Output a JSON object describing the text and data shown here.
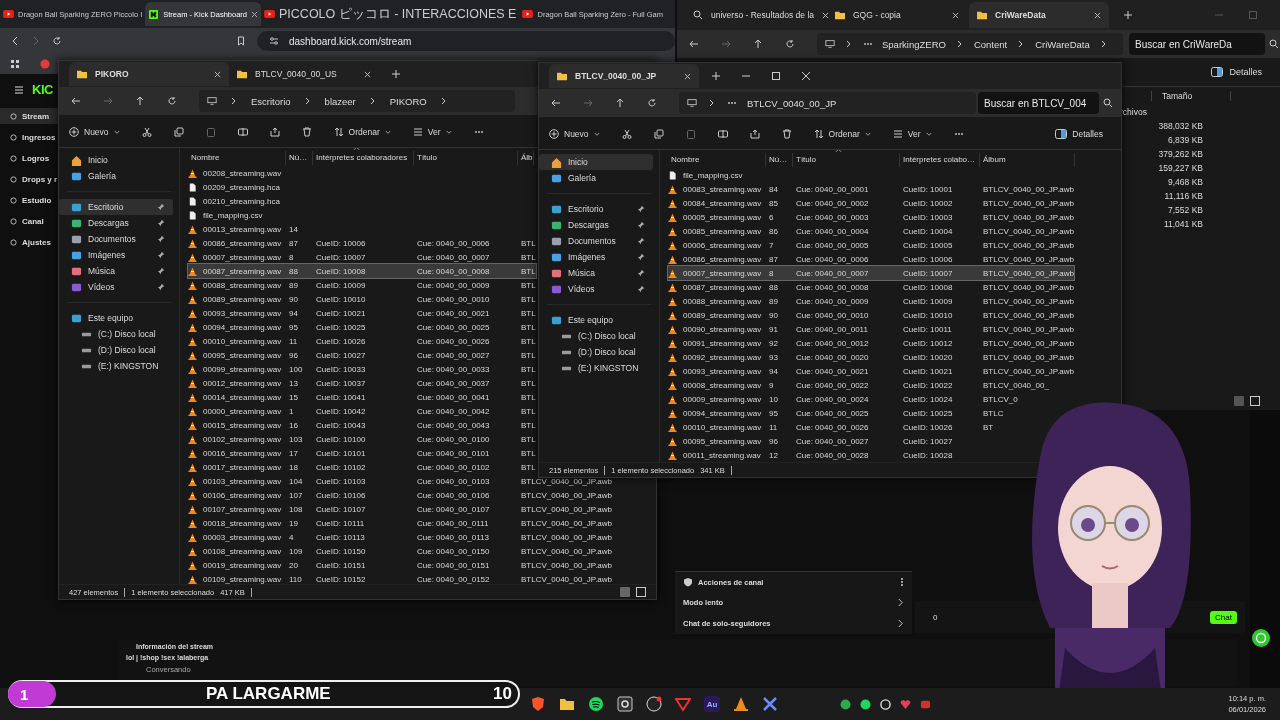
{
  "browser": {
    "tabs": [
      {
        "title": "Dragon Ball Sparking ZERO Piccolo I",
        "kind": "video",
        "selected": false
      },
      {
        "title": "Stream - Kick Dashboard",
        "kind": "kick",
        "selected": true
      },
      {
        "title": "PICCOLO ピッコロ - INTERACCIONES E",
        "kind": "video",
        "selected": false
      },
      {
        "title": "Dragon Ball Sparking Zero - Full Gam",
        "kind": "video",
        "selected": false
      }
    ],
    "url": "dashboard.kick.com/stream"
  },
  "kick": {
    "logo": "KIC",
    "nav": [
      {
        "label": "Stream",
        "selected": true
      },
      {
        "label": "Ingresos",
        "selected": false
      },
      {
        "label": "Logros",
        "selected": false
      },
      {
        "label": "Drops y r",
        "selected": false
      },
      {
        "label": "Estudio",
        "selected": false
      },
      {
        "label": "Canal",
        "selected": false
      },
      {
        "label": "Ajustes",
        "selected": false
      }
    ],
    "channel_actions": {
      "title": "Acciones de canal",
      "items": [
        "Modo lento",
        "Chat de solo-seguidores"
      ]
    },
    "chat": {
      "counter": "0",
      "button": "Chat"
    },
    "stream_info": {
      "title": "Información del stream",
      "stream_title": "lol | !shop !sex !alaberga",
      "category": "Conversando"
    }
  },
  "explorer_back": {
    "tabs": [
      {
        "title": "universo - Resultados de la",
        "kind": "search",
        "selected": false
      },
      {
        "title": "GQG - copia",
        "kind": "folder",
        "selected": false
      },
      {
        "title": "CriWareData",
        "kind": "folder",
        "selected": true
      }
    ],
    "path": [
      "SparkingZERO",
      "Content",
      "CriWareData"
    ],
    "search_placeholder": "Buscar en CriWareDa",
    "details_button": "Detalles",
    "column": "Tamaño",
    "group": "rchivos",
    "sizes": [
      "388,032 KB",
      "6,839 KB",
      "379,262 KB",
      "159,227 KB",
      "9,468 KB",
      "11,116 KB",
      "7,552 KB",
      "11,041 KB"
    ]
  },
  "explorer_left": {
    "tabs": [
      {
        "title": "PIKORO",
        "selected": true
      },
      {
        "title": "BTLCV_0040_00_US",
        "selected": false
      }
    ],
    "path": [
      "Escritorio",
      "blazeer",
      "PIKORO"
    ],
    "toolbar": {
      "new": "Nuevo",
      "sort": "Ordenar",
      "view": "Ver"
    },
    "nav": [
      {
        "label": "Inicio",
        "kind": "home",
        "pinned": false,
        "selected": false
      },
      {
        "label": "Galería",
        "kind": "gallery",
        "pinned": false,
        "selected": false
      },
      {
        "label": "Escritorio",
        "kind": "desktop",
        "pinned": true,
        "selected": true
      },
      {
        "label": "Descargas",
        "kind": "downloads",
        "pinned": true,
        "selected": false
      },
      {
        "label": "Documentos",
        "kind": "documents",
        "pinned": true,
        "selected": false
      },
      {
        "label": "Imágenes",
        "kind": "pictures",
        "pinned": true,
        "selected": false
      },
      {
        "label": "Música",
        "kind": "music",
        "pinned": true,
        "selected": false
      },
      {
        "label": "Vídeos",
        "kind": "videos",
        "pinned": true,
        "selected": false
      },
      {
        "label": "Este equipo",
        "kind": "pc",
        "pinned": false,
        "selected": false,
        "children": [
          {
            "label": "(C:) Disco local",
            "kind": "drive",
            "pinned": false,
            "selected": false
          },
          {
            "label": "(D:) Disco local",
            "kind": "drive",
            "pinned": false,
            "selected": false
          },
          {
            "label": "(E:) KINGSTON",
            "kind": "drive",
            "pinned": false,
            "selected": false
          }
        ]
      }
    ],
    "columns": [
      {
        "label": "Nombre",
        "sorted": false
      },
      {
        "label": "Nú…",
        "sorted": false
      },
      {
        "label": "Intérpretes colaboradores",
        "sorted": true
      },
      {
        "label": "Título",
        "sorted": false
      },
      {
        "label": "Álb",
        "sorted": false
      }
    ],
    "rows": [
      {
        "kind": "audio",
        "selected": false,
        "cells": [
          "00208_streaming.wav"
        ]
      },
      {
        "kind": "file",
        "selected": false,
        "cells": [
          "00209_streaming.hca"
        ]
      },
      {
        "kind": "file",
        "selected": false,
        "cells": [
          "00210_streaming.hca"
        ]
      },
      {
        "kind": "file",
        "selected": false,
        "cells": [
          "file_mapping.csv"
        ]
      },
      {
        "kind": "audio",
        "selected": false,
        "cells": [
          "00013_streaming.wav",
          "14"
        ]
      },
      {
        "kind": "audio",
        "selected": false,
        "cells": [
          "00086_streaming.wav",
          "87",
          "CueID: 10006",
          "Cue: 0040_00_0006",
          "BTL"
        ]
      },
      {
        "kind": "audio",
        "selected": false,
        "cells": [
          "00007_streaming.wav",
          "8",
          "CueID: 10007",
          "Cue: 0040_00_0007",
          "BTL"
        ]
      },
      {
        "kind": "audio",
        "selected": true,
        "cells": [
          "00087_streaming.wav",
          "88",
          "CueID: 10008",
          "Cue: 0040_00_0008",
          "BTL"
        ]
      },
      {
        "kind": "audio",
        "selected": false,
        "cells": [
          "00088_streaming.wav",
          "89",
          "CueID: 10009",
          "Cue: 0040_00_0009",
          "BTL"
        ]
      },
      {
        "kind": "audio",
        "selected": false,
        "cells": [
          "00089_streaming.wav",
          "90",
          "CueID: 10010",
          "Cue: 0040_00_0010",
          "BTL"
        ]
      },
      {
        "kind": "audio",
        "selected": false,
        "cells": [
          "00093_streaming.wav",
          "94",
          "CueID: 10021",
          "Cue: 0040_00_0021",
          "BTL"
        ]
      },
      {
        "kind": "audio",
        "selected": false,
        "cells": [
          "00094_streaming.wav",
          "95",
          "CueID: 10025",
          "Cue: 0040_00_0025",
          "BTL"
        ]
      },
      {
        "kind": "audio",
        "selected": false,
        "cells": [
          "00010_streaming.wav",
          "11",
          "CueID: 10026",
          "Cue: 0040_00_0026",
          "BTL"
        ]
      },
      {
        "kind": "audio",
        "selected": false,
        "cells": [
          "00095_streaming.wav",
          "96",
          "CueID: 10027",
          "Cue: 0040_00_0027",
          "BTL"
        ]
      },
      {
        "kind": "audio",
        "selected": false,
        "cells": [
          "00099_streaming.wav",
          "100",
          "CueID: 10033",
          "Cue: 0040_00_0033",
          "BTL"
        ]
      },
      {
        "kind": "audio",
        "selected": false,
        "cells": [
          "00012_streaming.wav",
          "13",
          "CueID: 10037",
          "Cue: 0040_00_0037",
          "BTL"
        ]
      },
      {
        "kind": "audio",
        "selected": false,
        "cells": [
          "00014_streaming.wav",
          "15",
          "CueID: 10041",
          "Cue: 0040_00_0041",
          "BTL"
        ]
      },
      {
        "kind": "audio",
        "selected": false,
        "cells": [
          "00000_streaming.wav",
          "1",
          "CueID: 10042",
          "Cue: 0040_00_0042",
          "BTL"
        ]
      },
      {
        "kind": "audio",
        "selected": false,
        "cells": [
          "00015_streaming.wav",
          "16",
          "CueID: 10043",
          "Cue: 0040_00_0043",
          "BTL"
        ]
      },
      {
        "kind": "audio",
        "selected": false,
        "cells": [
          "00102_streaming.wav",
          "103",
          "CueID: 10100",
          "Cue: 0040_00_0100",
          "BTL"
        ]
      },
      {
        "kind": "audio",
        "selected": false,
        "cells": [
          "00016_streaming.wav",
          "17",
          "CueID: 10101",
          "Cue: 0040_00_0101",
          "BTL"
        ]
      },
      {
        "kind": "audio",
        "selected": false,
        "cells": [
          "00017_streaming.wav",
          "18",
          "CueID: 10102",
          "Cue: 0040_00_0102",
          "BTL"
        ]
      },
      {
        "kind": "audio",
        "selected": false,
        "cells": [
          "00103_streaming.wav",
          "104",
          "CueID: 10103",
          "Cue: 0040_00_0103",
          "BTLCV_0040_00_JP.awb"
        ]
      },
      {
        "kind": "audio",
        "selected": false,
        "cells": [
          "00106_streaming.wav",
          "107",
          "CueID: 10106",
          "Cue: 0040_00_0106",
          "BTLCV_0040_00_JP.awb"
        ]
      },
      {
        "kind": "audio",
        "selected": false,
        "cells": [
          "00107_streaming.wav",
          "108",
          "CueID: 10107",
          "Cue: 0040_00_0107",
          "BTLCV_0040_00_JP.awb"
        ]
      },
      {
        "kind": "audio",
        "selected": false,
        "cells": [
          "00018_streaming.wav",
          "19",
          "CueID: 10111",
          "Cue: 0040_00_0111",
          "BTLCV_0040_00_JP.awb"
        ]
      },
      {
        "kind": "audio",
        "selected": false,
        "cells": [
          "00003_streaming.wav",
          "4",
          "CueID: 10113",
          "Cue: 0040_00_0113",
          "BTLCV_0040_00_JP.awb"
        ]
      },
      {
        "kind": "audio",
        "selected": false,
        "cells": [
          "00108_streaming.wav",
          "109",
          "CueID: 10150",
          "Cue: 0040_00_0150",
          "BTLCV_0040_00_JP.awb"
        ]
      },
      {
        "kind": "audio",
        "selected": false,
        "cells": [
          "00019_streaming.wav",
          "20",
          "CueID: 10151",
          "Cue: 0040_00_0151",
          "BTLCV_0040_00_JP.awb"
        ]
      },
      {
        "kind": "audio",
        "selected": false,
        "cells": [
          "00109_streaming.wav",
          "110",
          "CueID: 10152",
          "Cue: 0040_00_0152",
          "BTLCV_0040_00_JP.awb"
        ]
      }
    ],
    "status": {
      "count": "427 elementos",
      "selection": "1 elemento seleccionado",
      "size": "417 KB"
    }
  },
  "explorer_jp": {
    "tabs": [
      {
        "title": "BTLCV_0040_00_JP",
        "selected": true
      }
    ],
    "path": [
      "BTLCV_0040_00_JP"
    ],
    "search_placeholder": "Buscar en BTLCV_004",
    "toolbar": {
      "new": "Nuevo",
      "sort": "Ordenar",
      "view": "Ver",
      "details": "Detalles"
    },
    "nav": [
      {
        "label": "Inicio",
        "kind": "home",
        "pinned": false,
        "selected": true
      },
      {
        "label": "Galería",
        "kind": "gallery",
        "pinned": false,
        "selected": false
      },
      {
        "label": "Escritorio",
        "kind": "desktop",
        "pinned": true,
        "selected": false
      },
      {
        "label": "Descargas",
        "kind": "downloads",
        "pinned": true,
        "selected": false
      },
      {
        "label": "Documentos",
        "kind": "documents",
        "pinned": true,
        "selected": false
      },
      {
        "label": "Imágenes",
        "kind": "pictures",
        "pinned": true,
        "selected": false
      },
      {
        "label": "Música",
        "kind": "music",
        "pinned": true,
        "selected": false
      },
      {
        "label": "Vídeos",
        "kind": "videos",
        "pinned": true,
        "selected": false
      },
      {
        "label": "Este equipo",
        "kind": "pc",
        "pinned": false,
        "selected": false,
        "children": [
          {
            "label": "(C:) Disco local",
            "kind": "drive",
            "pinned": false,
            "selected": false
          },
          {
            "label": "(D:) Disco local",
            "kind": "drive",
            "pinned": false,
            "selected": false
          },
          {
            "label": "(E:) KINGSTON",
            "kind": "drive",
            "pinned": false,
            "selected": false
          }
        ]
      }
    ],
    "columns": [
      {
        "label": "Nombre",
        "sorted": false
      },
      {
        "label": "Nú…",
        "sorted": false
      },
      {
        "label": "Título",
        "sorted": true
      },
      {
        "label": "Intérpretes colabo…",
        "sorted": false
      },
      {
        "label": "Álbum",
        "sorted": false
      }
    ],
    "rows": [
      {
        "kind": "file",
        "selected": false,
        "cells": [
          "file_mapping.csv"
        ]
      },
      {
        "kind": "audio",
        "selected": false,
        "cells": [
          "00083_streaming.wav",
          "84",
          "Cue: 0040_00_0001",
          "CueID: 10001",
          "BTLCV_0040_00_JP.awb"
        ]
      },
      {
        "kind": "audio",
        "selected": false,
        "cells": [
          "00084_streaming.wav",
          "85",
          "Cue: 0040_00_0002",
          "CueID: 10002",
          "BTLCV_0040_00_JP.awb"
        ]
      },
      {
        "kind": "audio",
        "selected": false,
        "cells": [
          "00005_streaming.wav",
          "6",
          "Cue: 0040_00_0003",
          "CueID: 10003",
          "BTLCV_0040_00_JP.awb"
        ]
      },
      {
        "kind": "audio",
        "selected": false,
        "cells": [
          "00085_streaming.wav",
          "86",
          "Cue: 0040_00_0004",
          "CueID: 10004",
          "BTLCV_0040_00_JP.awb"
        ]
      },
      {
        "kind": "audio",
        "selected": false,
        "cells": [
          "00006_streaming.wav",
          "7",
          "Cue: 0040_00_0005",
          "CueID: 10005",
          "BTLCV_0040_00_JP.awb"
        ]
      },
      {
        "kind": "audio",
        "selected": false,
        "cells": [
          "00086_streaming.wav",
          "87",
          "Cue: 0040_00_0006",
          "CueID: 10006",
          "BTLCV_0040_00_JP.awb"
        ]
      },
      {
        "kind": "audio",
        "selected": true,
        "cells": [
          "00007_streaming.wav",
          "8",
          "Cue: 0040_00_0007",
          "CueID: 10007",
          "BTLCV_0040_00_JP.awb"
        ]
      },
      {
        "kind": "audio",
        "selected": false,
        "cells": [
          "00087_streaming.wav",
          "88",
          "Cue: 0040_00_0008",
          "CueID: 10008",
          "BTLCV_0040_00_JP.awb"
        ]
      },
      {
        "kind": "audio",
        "selected": false,
        "cells": [
          "00088_streaming.wav",
          "89",
          "Cue: 0040_00_0009",
          "CueID: 10009",
          "BTLCV_0040_00_JP.awb"
        ]
      },
      {
        "kind": "audio",
        "selected": false,
        "cells": [
          "00089_streaming.wav",
          "90",
          "Cue: 0040_00_0010",
          "CueID: 10010",
          "BTLCV_0040_00_JP.awb"
        ]
      },
      {
        "kind": "audio",
        "selected": false,
        "cells": [
          "00090_streaming.wav",
          "91",
          "Cue: 0040_00_0011",
          "CueID: 10011",
          "BTLCV_0040_00_JP.awb"
        ]
      },
      {
        "kind": "audio",
        "selected": false,
        "cells": [
          "00091_streaming.wav",
          "92",
          "Cue: 0040_00_0012",
          "CueID: 10012",
          "BTLCV_0040_00_JP.awb"
        ]
      },
      {
        "kind": "audio",
        "selected": false,
        "cells": [
          "00092_streaming.wav",
          "93",
          "Cue: 0040_00_0020",
          "CueID: 10020",
          "BTLCV_0040_00_JP.awb"
        ]
      },
      {
        "kind": "audio",
        "selected": false,
        "cells": [
          "00093_streaming.wav",
          "94",
          "Cue: 0040_00_0021",
          "CueID: 10021",
          "BTLCV_0040_00_JP.awb"
        ]
      },
      {
        "kind": "audio",
        "selected": false,
        "cells": [
          "00008_streaming.wav",
          "9",
          "Cue: 0040_00_0022",
          "CueID: 10022",
          "BTLCV_0040_00_"
        ]
      },
      {
        "kind": "audio",
        "selected": false,
        "cells": [
          "00009_streaming.wav",
          "10",
          "Cue: 0040_00_0024",
          "CueID: 10024",
          "BTLCV_0"
        ]
      },
      {
        "kind": "audio",
        "selected": false,
        "cells": [
          "00094_streaming.wav",
          "95",
          "Cue: 0040_00_0025",
          "CueID: 10025",
          "BTLC"
        ]
      },
      {
        "kind": "audio",
        "selected": false,
        "cells": [
          "00010_streaming.wav",
          "11",
          "Cue: 0040_00_0026",
          "CueID: 10026",
          "BT"
        ]
      },
      {
        "kind": "audio",
        "selected": false,
        "cells": [
          "00095_streaming.wav",
          "96",
          "Cue: 0040_00_0027",
          "CueID: 10027"
        ]
      },
      {
        "kind": "audio",
        "selected": false,
        "cells": [
          "00011_streaming.wav",
          "12",
          "Cue: 0040_00_0028",
          "CueID: 10028"
        ]
      }
    ],
    "status": {
      "count": "215 elementos",
      "selection": "1 elemento seleccionado",
      "size": "341 KB"
    }
  },
  "overlay_bar": {
    "rank": "1",
    "title": "PA LARGARME",
    "count": "10"
  },
  "taskbar": {
    "app_label": "Au",
    "time": "10:14 p. m.",
    "date": "06/01/2026"
  }
}
